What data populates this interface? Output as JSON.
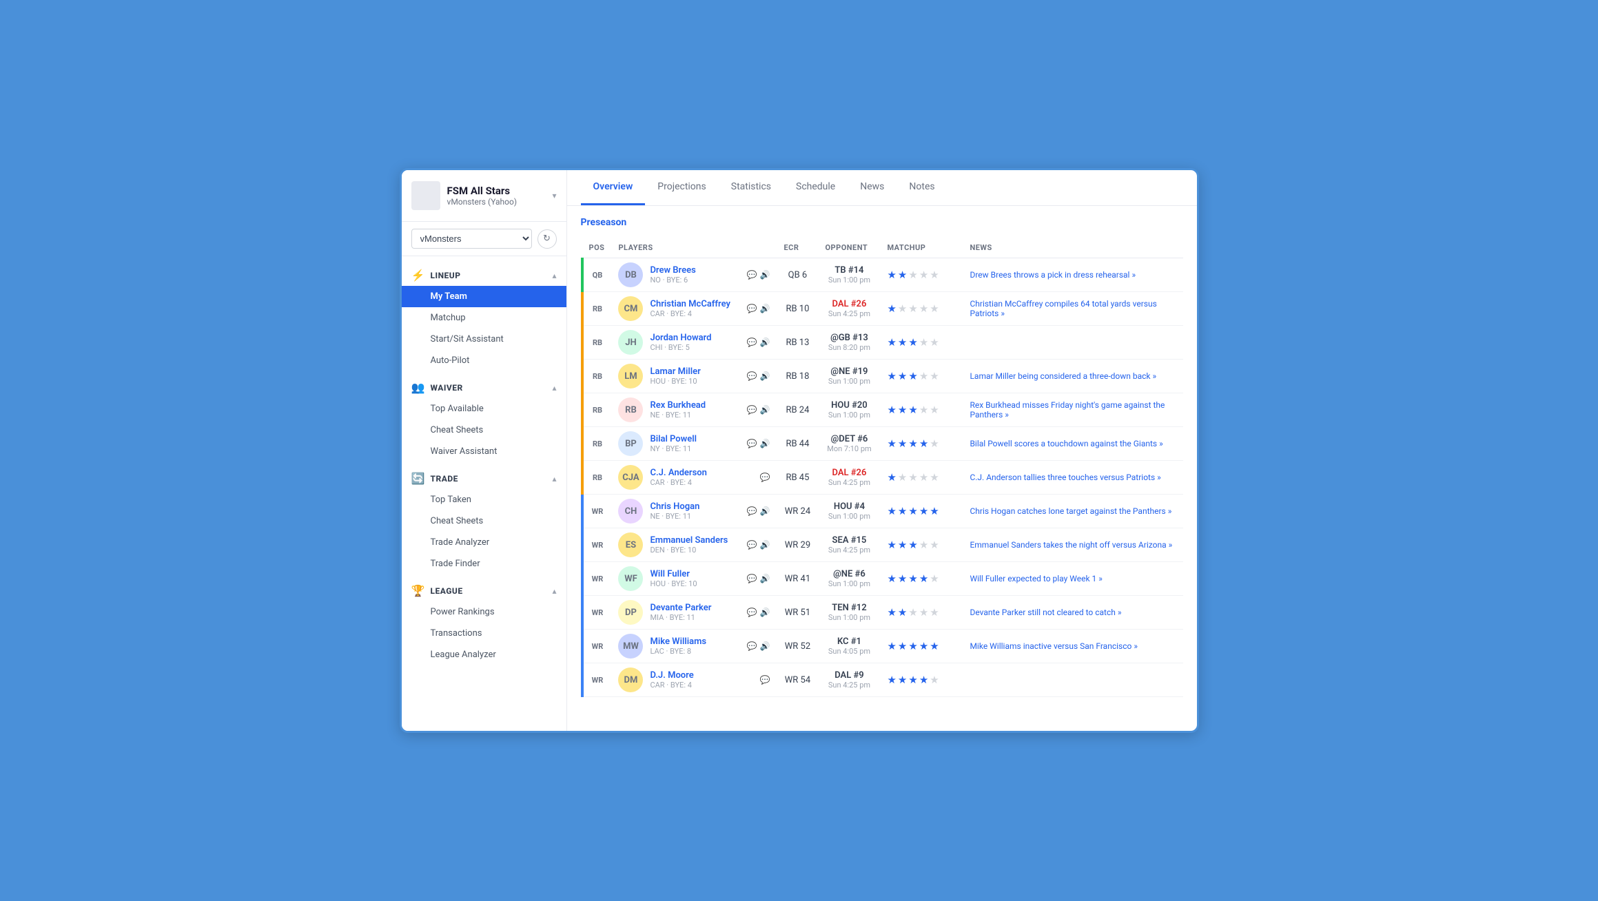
{
  "sidebar": {
    "logo_alt": "FSM",
    "team_name": "FSM All Stars",
    "league": "vMonsters (Yahoo)",
    "dropdown_value": "vMonsters",
    "sections": [
      {
        "id": "lineup",
        "icon": "⚡",
        "title": "LINEUP",
        "items": [
          {
            "id": "my-team",
            "label": "My Team",
            "active": true
          },
          {
            "id": "matchup",
            "label": "Matchup",
            "active": false
          },
          {
            "id": "start-sit",
            "label": "Start/Sit Assistant",
            "active": false
          },
          {
            "id": "auto-pilot",
            "label": "Auto-Pilot",
            "active": false
          }
        ]
      },
      {
        "id": "waiver",
        "icon": "👥",
        "title": "WAIVER",
        "items": [
          {
            "id": "top-available",
            "label": "Top Available",
            "active": false
          },
          {
            "id": "cheat-sheets-waiver",
            "label": "Cheat Sheets",
            "active": false
          },
          {
            "id": "waiver-assistant",
            "label": "Waiver Assistant",
            "active": false
          }
        ]
      },
      {
        "id": "trade",
        "icon": "🔄",
        "title": "TRADE",
        "items": [
          {
            "id": "top-taken",
            "label": "Top Taken",
            "active": false
          },
          {
            "id": "cheat-sheets-trade",
            "label": "Cheat Sheets",
            "active": false
          },
          {
            "id": "trade-analyzer",
            "label": "Trade Analyzer",
            "active": false
          },
          {
            "id": "trade-finder",
            "label": "Trade Finder",
            "active": false
          }
        ]
      },
      {
        "id": "league",
        "icon": "🏆",
        "title": "LEAGUE",
        "items": [
          {
            "id": "power-rankings",
            "label": "Power Rankings",
            "active": false
          },
          {
            "id": "transactions",
            "label": "Transactions",
            "active": false
          },
          {
            "id": "league-analyzer",
            "label": "League Analyzer",
            "active": false
          }
        ]
      }
    ]
  },
  "tabs": [
    {
      "id": "overview",
      "label": "Overview",
      "active": true
    },
    {
      "id": "projections",
      "label": "Projections",
      "active": false
    },
    {
      "id": "statistics",
      "label": "Statistics",
      "active": false
    },
    {
      "id": "schedule",
      "label": "Schedule",
      "active": false
    },
    {
      "id": "news",
      "label": "News",
      "active": false
    },
    {
      "id": "notes",
      "label": "Notes",
      "active": false
    }
  ],
  "preseason_label": "Preseason",
  "table": {
    "columns": [
      "POS",
      "PLAYERS",
      "ECR",
      "OPPONENT",
      "MATCHUP",
      "NEWS"
    ],
    "rows": [
      {
        "pos": "QB",
        "pos_class": "qb",
        "name": "Drew Brees",
        "team_bye": "NO · BYE: 6",
        "ecr": "QB 6",
        "opponent": "TB #14",
        "opp_time": "Sun 1:00 pm",
        "opp_bad": false,
        "stars": [
          1,
          1,
          0,
          0,
          0
        ],
        "news": "Drew Brees throws a pick in dress rehearsal »",
        "initials": "DB",
        "avatar_color": "#c7d2fe"
      },
      {
        "pos": "RB",
        "pos_class": "rb",
        "name": "Christian McCaffrey",
        "team_bye": "CAR · BYE: 4",
        "ecr": "RB 10",
        "opponent": "DAL #26",
        "opp_time": "Sun 4:25 pm",
        "opp_bad": true,
        "stars": [
          1,
          0,
          0,
          0,
          0
        ],
        "news": "Christian McCaffrey compiles 64 total yards versus Patriots »",
        "initials": "CM",
        "avatar_color": "#fde68a"
      },
      {
        "pos": "RB",
        "pos_class": "rb",
        "name": "Jordan Howard",
        "team_bye": "CHI · BYE: 5",
        "ecr": "RB 13",
        "opponent": "@GB #13",
        "opp_time": "Sun 8:20 pm",
        "opp_bad": false,
        "stars": [
          1,
          1,
          1,
          0,
          0
        ],
        "news": "",
        "initials": "JH",
        "avatar_color": "#d1fae5"
      },
      {
        "pos": "RB",
        "pos_class": "rb",
        "name": "Lamar Miller",
        "team_bye": "HOU · BYE: 10",
        "ecr": "RB 18",
        "opponent": "@NE #19",
        "opp_time": "Sun 1:00 pm",
        "opp_bad": false,
        "stars": [
          1,
          1,
          1,
          0,
          0
        ],
        "news": "Lamar Miller being considered a three-down back »",
        "initials": "LM",
        "avatar_color": "#fde68a"
      },
      {
        "pos": "RB",
        "pos_class": "rb",
        "name": "Rex Burkhead",
        "team_bye": "NE · BYE: 11",
        "ecr": "RB 24",
        "opponent": "HOU #20",
        "opp_time": "Sun 1:00 pm",
        "opp_bad": false,
        "stars": [
          1,
          1,
          1,
          0,
          0
        ],
        "news": "Rex Burkhead misses Friday night's game against the Panthers »",
        "initials": "RB",
        "avatar_color": "#fee2e2"
      },
      {
        "pos": "RB",
        "pos_class": "rb",
        "name": "Bilal Powell",
        "team_bye": "NY · BYE: 11",
        "ecr": "RB 44",
        "opponent": "@DET #6",
        "opp_time": "Mon 7:10 pm",
        "opp_bad": false,
        "stars": [
          1,
          1,
          1,
          1,
          0
        ],
        "news": "Bilal Powell scores a touchdown against the Giants »",
        "initials": "BP",
        "avatar_color": "#dbeafe"
      },
      {
        "pos": "RB",
        "pos_class": "rb",
        "name": "C.J. Anderson",
        "team_bye": "CAR · BYE: 4",
        "ecr": "RB 45",
        "opponent": "DAL #26",
        "opp_time": "Sun 4:25 pm",
        "opp_bad": true,
        "stars": [
          1,
          0,
          0,
          0,
          0
        ],
        "news": "C.J. Anderson tallies three touches versus Patriots »",
        "initials": "CJA",
        "avatar_color": "#fde68a"
      },
      {
        "pos": "WR",
        "pos_class": "wr",
        "name": "Chris Hogan",
        "team_bye": "NE · BYE: 11",
        "ecr": "WR 24",
        "opponent": "HOU #4",
        "opp_time": "Sun 1:00 pm",
        "opp_bad": false,
        "stars": [
          1,
          1,
          1,
          1,
          1
        ],
        "news": "Chris Hogan catches lone target against the Panthers »",
        "initials": "CH",
        "avatar_color": "#e9d5ff"
      },
      {
        "pos": "WR",
        "pos_class": "wr",
        "name": "Emmanuel Sanders",
        "team_bye": "DEN · BYE: 10",
        "ecr": "WR 29",
        "opponent": "SEA #15",
        "opp_time": "Sun 4:25 pm",
        "opp_bad": false,
        "stars": [
          1,
          1,
          1,
          0,
          0
        ],
        "news": "Emmanuel Sanders takes the night off versus Arizona »",
        "initials": "ES",
        "avatar_color": "#fde68a"
      },
      {
        "pos": "WR",
        "pos_class": "wr",
        "name": "Will Fuller",
        "team_bye": "HOU · BYE: 10",
        "ecr": "WR 41",
        "opponent": "@NE #6",
        "opp_time": "Sun 1:00 pm",
        "opp_bad": false,
        "stars": [
          1,
          1,
          1,
          1,
          0
        ],
        "news": "Will Fuller expected to play Week 1 »",
        "initials": "WF",
        "avatar_color": "#d1fae5"
      },
      {
        "pos": "WR",
        "pos_class": "wr",
        "name": "Devante Parker",
        "team_bye": "MIA · BYE: 11",
        "ecr": "WR 51",
        "opponent": "TEN #12",
        "opp_time": "Sun 1:00 pm",
        "opp_bad": false,
        "stars": [
          1,
          1,
          0,
          0,
          0
        ],
        "news": "Devante Parker still not cleared to catch »",
        "initials": "DP",
        "avatar_color": "#fef9c3"
      },
      {
        "pos": "WR",
        "pos_class": "wr",
        "name": "Mike Williams",
        "team_bye": "LAC · BYE: 8",
        "ecr": "WR 52",
        "opponent": "KC #1",
        "opp_time": "Sun 4:05 pm",
        "opp_bad": false,
        "stars": [
          1,
          1,
          1,
          1,
          1
        ],
        "news": "Mike Williams inactive versus San Francisco »",
        "initials": "MW",
        "avatar_color": "#c7d2fe"
      },
      {
        "pos": "WR",
        "pos_class": "wr",
        "name": "D.J. Moore",
        "team_bye": "CAR · BYE: 4",
        "ecr": "WR 54",
        "opponent": "DAL #9",
        "opp_time": "Sun 4:25 pm",
        "opp_bad": false,
        "stars": [
          1,
          1,
          1,
          1,
          0
        ],
        "news": "",
        "initials": "DM",
        "avatar_color": "#fde68a"
      }
    ]
  }
}
